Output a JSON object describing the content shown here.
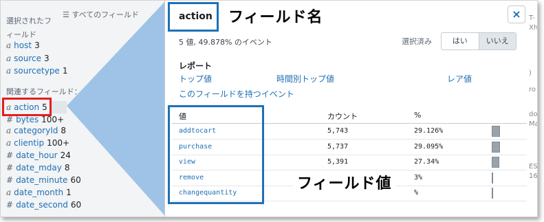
{
  "sidebar": {
    "selected_title": "選択されたフィールド",
    "all_fields_label": "すべてのフィールド",
    "related_title": "関連するフィールド：",
    "selected_fields": [
      {
        "type": "a",
        "name": "host",
        "count": "3"
      },
      {
        "type": "a",
        "name": "source",
        "count": "3"
      },
      {
        "type": "a",
        "name": "sourcetype",
        "count": "1"
      }
    ],
    "related_fields": [
      {
        "type": "a",
        "name": "action",
        "count": "5"
      },
      {
        "type": "#",
        "name": "bytes",
        "count": "100+"
      },
      {
        "type": "a",
        "name": "categoryId",
        "count": "8"
      },
      {
        "type": "a",
        "name": "clientip",
        "count": "100+"
      },
      {
        "type": "#",
        "name": "date_hour",
        "count": "24"
      },
      {
        "type": "#",
        "name": "date_mday",
        "count": "8"
      },
      {
        "type": "#",
        "name": "date_minute",
        "count": "60"
      },
      {
        "type": "a",
        "name": "date_month",
        "count": "1"
      },
      {
        "type": "#",
        "name": "date_second",
        "count": "60"
      }
    ]
  },
  "popup": {
    "field_name": "action",
    "close_icon": "×",
    "summary": "5 値, 49.878% のイベント",
    "selected_label": "選択済み",
    "toggle": {
      "yes": "はい",
      "no": "いいえ"
    },
    "report_heading": "レポート",
    "report_links": {
      "top": "トップ値",
      "time_top": "時間別トップ値",
      "rare": "レア値"
    },
    "events_link": "このフィールドを持つイベント",
    "table": {
      "headers": {
        "value": "値",
        "count": "カウント",
        "percent": "%"
      },
      "rows": [
        {
          "value": "addtocart",
          "count": "5,743",
          "percent": "29.126%",
          "bar": 29.126
        },
        {
          "value": "purchase",
          "count": "5,737",
          "percent": "29.095%",
          "bar": 29.095
        },
        {
          "value": "view",
          "count": "5,391",
          "percent": "27.34%",
          "bar": 27.34
        },
        {
          "value": "remove",
          "count": "",
          "percent": "3%",
          "bar": 3
        },
        {
          "value": "changequantity",
          "count": "",
          "percent": "%",
          "bar": 3
        }
      ]
    }
  },
  "annotations": {
    "field_name": "フィールド名",
    "field_values": "フィールド値"
  },
  "colors": {
    "link": "#1e6fb5",
    "callout": "#1d70b8",
    "highlight": "#e61c1c"
  }
}
